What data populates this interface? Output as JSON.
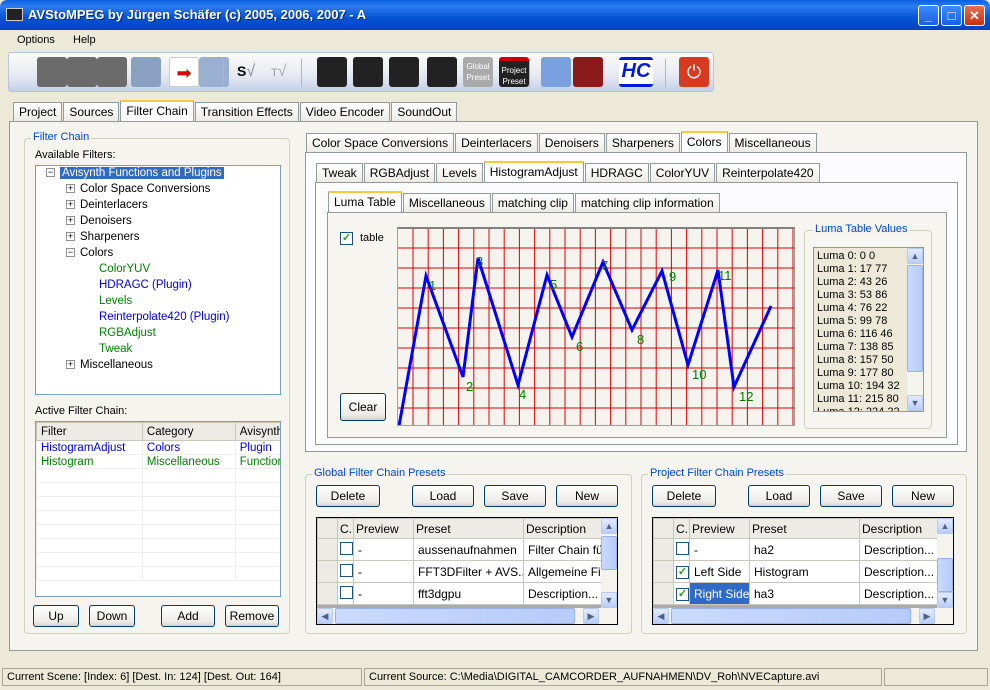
{
  "window": {
    "title": "AVStoMPEG by Jürgen Schäfer (c) 2005, 2006, 2007 - A"
  },
  "menu": [
    "Options",
    "Help"
  ],
  "toolbar": {
    "icons": [
      "add-scene-icon",
      "scene-icon",
      "remove-scene-icon",
      "import-scene-icon",
      "export-icon",
      "recycle-bin-icon",
      "s-check-icon",
      "t-check-icon",
      "add-clip-icon",
      "clapper-icon",
      "clapper-2-icon",
      "clapper-3-icon",
      "global-preset-icon",
      "project-preset-icon",
      "calculator-icon",
      "film-disc-icon",
      "hc-icon",
      "power-icon"
    ],
    "global_preset": "Global Preset",
    "project_preset": "Project Preset",
    "hc": "HC",
    "s": "S",
    "t": "T"
  },
  "main_tabs": [
    "Project",
    "Sources",
    "Filter Chain",
    "Transition Effects",
    "Video Encoder",
    "SoundOut"
  ],
  "main_tab_active": 2,
  "filter_chain": {
    "title": "Filter Chain",
    "available_label": "Available Filters:",
    "tree": {
      "root": "Avisynth Functions and Plugins",
      "cats": [
        "Color Space Conversions",
        "Deinterlacers",
        "Denoisers",
        "Sharpeners",
        "Colors",
        "Miscellaneous"
      ],
      "colors_children": [
        {
          "label": "ColorYUV",
          "kind": "function"
        },
        {
          "label": "HDRAGC (Plugin)",
          "kind": "plugin"
        },
        {
          "label": "Levels",
          "kind": "function"
        },
        {
          "label": "Reinterpolate420 (Plugin)",
          "kind": "plugin"
        },
        {
          "label": "RGBAdjust",
          "kind": "function"
        },
        {
          "label": "Tweak",
          "kind": "function"
        }
      ]
    },
    "active_label": "Active Filter Chain:",
    "active_columns": [
      "Filter",
      "Category",
      "Avisynth"
    ],
    "active_rows": [
      [
        "HistogramAdjust",
        "Colors",
        "Plugin"
      ],
      [
        "Histogram",
        "Miscellaneous",
        "Function"
      ]
    ],
    "buttons": {
      "up": "Up",
      "down": "Down",
      "add": "Add",
      "remove": "Remove"
    }
  },
  "category_tabs": [
    "Color Space Conversions",
    "Deinterlacers",
    "Denoisers",
    "Sharpeners",
    "Colors",
    "Miscellaneous"
  ],
  "filter_tabs": [
    "Tweak",
    "RGBAdjust",
    "Levels",
    "HistogramAdjust",
    "HDRAGC",
    "ColorYUV",
    "Reinterpolate420"
  ],
  "sub_tabs": [
    "Luma Table",
    "Miscellaneous",
    "matching clip",
    "matching clip information"
  ],
  "luma": {
    "table_label": "table",
    "table_checked": true,
    "clear": "Clear",
    "point_labels": [
      "1",
      "2",
      "3",
      "4",
      "5",
      "6",
      "7",
      "8",
      "9",
      "10",
      "11",
      "12"
    ],
    "values_title": "Luma Table Values",
    "values": [
      "Luma 0: 0 0",
      "Luma 1: 17 77",
      "Luma 2: 43 26",
      "Luma 3: 53 86",
      "Luma 4: 76 22",
      "Luma 5: 99 78",
      "Luma 6: 116 46",
      "Luma 7: 138 85",
      "Luma 8: 157 50",
      "Luma 9: 177 80",
      "Luma 10: 194 32",
      "Luma 11: 215 80",
      "Luma 12: 224 22"
    ]
  },
  "colors": {
    "grid": "#e00000",
    "curve": "#0000ff",
    "labels": "#008000",
    "accent": "#316ac5"
  },
  "global_presets": {
    "title": "Global Filter Chain Presets",
    "delete": "Delete",
    "load": "Load",
    "save": "Save",
    "new": "New",
    "columns": [
      "C.",
      "Preview",
      "Preset",
      "Description"
    ],
    "rows": [
      {
        "checked": false,
        "preview": "-",
        "preset": "aussenaufnahmen",
        "desc": "Filter Chain für Au"
      },
      {
        "checked": false,
        "preview": "-",
        "preset": "FFT3DFilter + AVS...",
        "desc": "Allgemeine Filter"
      },
      {
        "checked": false,
        "preview": "-",
        "preset": "fft3dgpu",
        "desc": "Description..."
      }
    ]
  },
  "project_presets": {
    "title": "Project Filter Chain Presets",
    "delete": "Delete",
    "load": "Load",
    "save": "Save",
    "new": "New",
    "columns": [
      "C.",
      "Preview",
      "Preset",
      "Description"
    ],
    "rows": [
      {
        "checked": false,
        "preview": "-",
        "preset": "ha2",
        "desc": "Description..."
      },
      {
        "checked": true,
        "preview": "Left Side",
        "preset": "Histogram",
        "desc": "Description..."
      },
      {
        "checked": true,
        "preview": "Right Side",
        "preset": "ha3",
        "desc": "Description..."
      }
    ]
  },
  "status": {
    "scene": "Current Scene: [Index: 6] [Dest. In: 124] [Dest. Out: 164]",
    "source": "Current Source: C:\\Media\\DIGITAL_CAMCORDER_AUFNAHMEN\\DV_Roh\\NVECapture.avi"
  }
}
